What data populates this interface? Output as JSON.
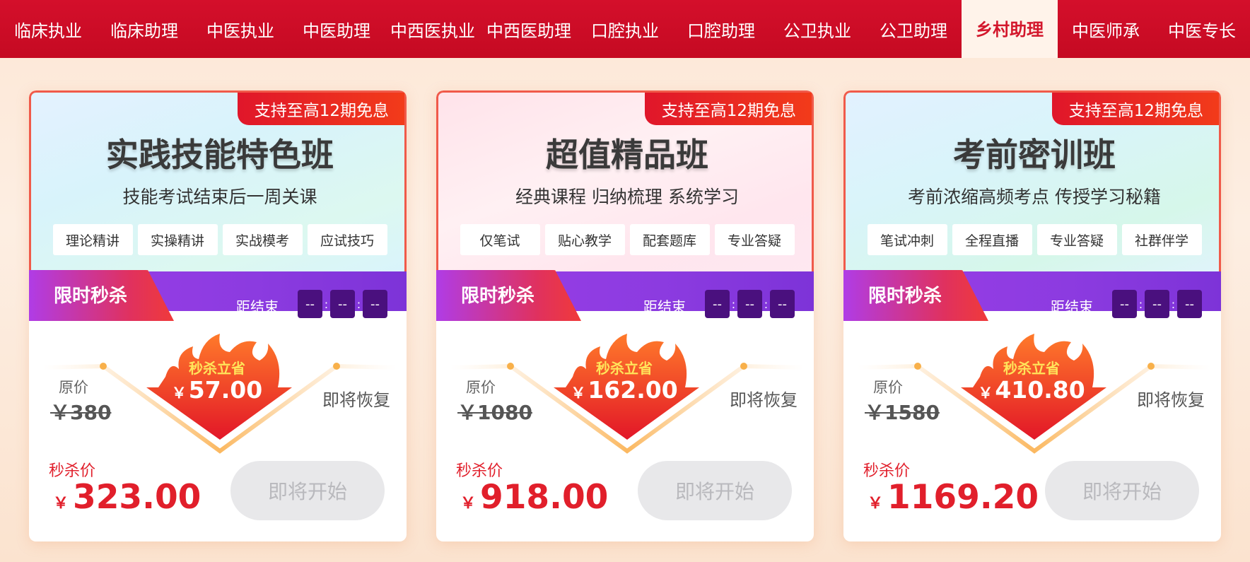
{
  "nav": {
    "items": [
      {
        "label": "临床执业"
      },
      {
        "label": "临床助理"
      },
      {
        "label": "中医执业"
      },
      {
        "label": "中医助理"
      },
      {
        "label": "中西医执业"
      },
      {
        "label": "中西医助理"
      },
      {
        "label": "口腔执业"
      },
      {
        "label": "口腔助理"
      },
      {
        "label": "公卫执业"
      },
      {
        "label": "公卫助理"
      },
      {
        "label": "乡村助理"
      },
      {
        "label": "中医师承"
      },
      {
        "label": "中医专长"
      }
    ],
    "active_index": 10
  },
  "colors": {
    "nav_bg": "#c50a22",
    "accent_red": "#e11f2b",
    "flash_purple": "#8c3be0",
    "timer_box": "#4a107e"
  },
  "cards": [
    {
      "badge": "支持至高12期免息",
      "title": "实践技能特色班",
      "subtitle": "技能考试结束后一周关课",
      "tags": [
        "理论精讲",
        "实操精讲",
        "实战模考",
        "应试技巧"
      ],
      "flash_label": "限时秒杀",
      "ends_label": "距结束",
      "timer": [
        "--",
        "--",
        "--"
      ],
      "orig_label": "原价",
      "orig_price": "￥380",
      "save_label": "秒杀立省",
      "save_yen": "￥",
      "save_amount": "57.00",
      "restore_label": "即将恢复",
      "sale_label": "秒杀价",
      "sale_yen": "￥",
      "sale_price": "323.00",
      "button_label": "即将开始"
    },
    {
      "badge": "支持至高12期免息",
      "title": "超值精品班",
      "subtitle": "经典课程 归纳梳理 系统学习",
      "tags": [
        "仅笔试",
        "贴心教学",
        "配套题库",
        "专业答疑"
      ],
      "flash_label": "限时秒杀",
      "ends_label": "距结束",
      "timer": [
        "--",
        "--",
        "--"
      ],
      "orig_label": "原价",
      "orig_price": "￥1080",
      "save_label": "秒杀立省",
      "save_yen": "￥",
      "save_amount": "162.00",
      "restore_label": "即将恢复",
      "sale_label": "秒杀价",
      "sale_yen": "￥",
      "sale_price": "918.00",
      "button_label": "即将开始"
    },
    {
      "badge": "支持至高12期免息",
      "title": "考前密训班",
      "subtitle": "考前浓缩高频考点 传授学习秘籍",
      "tags": [
        "笔试冲刺",
        "全程直播",
        "专业答疑",
        "社群伴学"
      ],
      "flash_label": "限时秒杀",
      "ends_label": "距结束",
      "timer": [
        "--",
        "--",
        "--"
      ],
      "orig_label": "原价",
      "orig_price": "￥1580",
      "save_label": "秒杀立省",
      "save_yen": "￥",
      "save_amount": "410.80",
      "restore_label": "即将恢复",
      "sale_label": "秒杀价",
      "sale_yen": "￥",
      "sale_price": "1169.20",
      "button_label": "即将开始"
    }
  ]
}
